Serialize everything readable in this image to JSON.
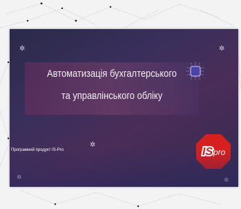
{
  "slide": {
    "title_line_1": "Автоматизація бухгалтерського",
    "title_line_2": "та управлінського обліку",
    "product_label": "Програмний продукт IS-Pro"
  },
  "logo": {
    "text_is": "IS",
    "text_pro": "pro",
    "badge_color": "#d6201f"
  },
  "icons": [
    "gear-icon",
    "chip-icon",
    "is-pro-logo"
  ],
  "colors": {
    "slide_background": "#35294f",
    "title_band": "#7a3a6a",
    "text": "#ffffff"
  }
}
